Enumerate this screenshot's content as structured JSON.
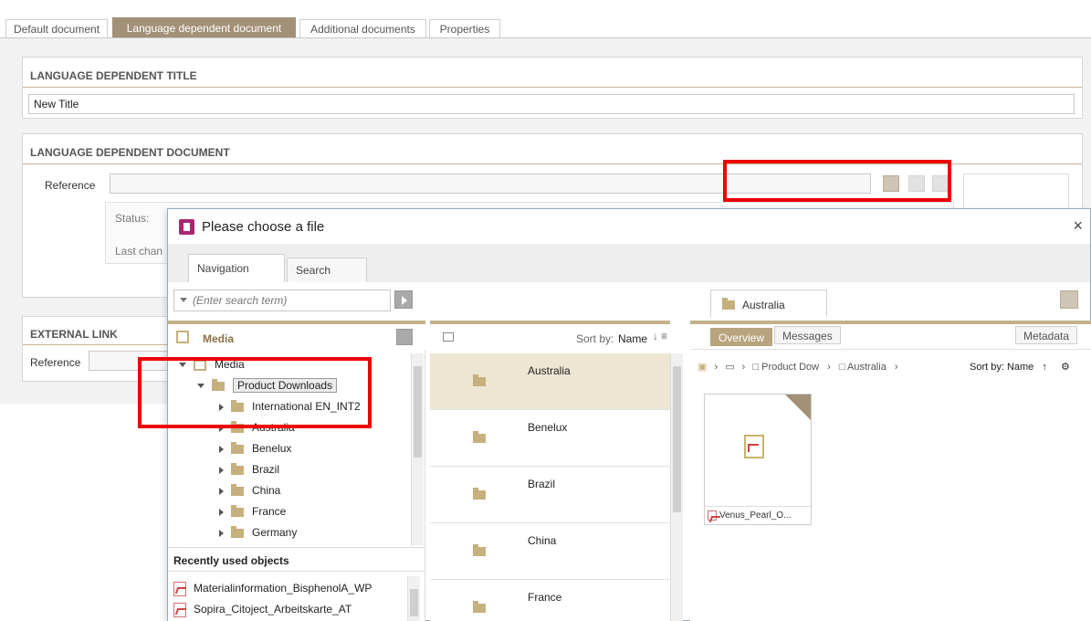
{
  "top_tabs": [
    {
      "label": "Default document"
    },
    {
      "label": "Language dependent document"
    },
    {
      "label": "Additional documents"
    },
    {
      "label": "Properties"
    }
  ],
  "title_panel": {
    "heading": "LANGUAGE DEPENDENT TITLE",
    "value": "New Title"
  },
  "doc_panel": {
    "heading": "LANGUAGE DEPENDENT DOCUMENT",
    "reference_label": "Reference",
    "status_label": "Status:",
    "last_changed_label": "Last chan"
  },
  "link_panel": {
    "heading": "EXTERNAL LINK",
    "reference_label": "Reference"
  },
  "dialog": {
    "title": "Please choose a file",
    "close_label": "×",
    "tabs": [
      {
        "label": "Navigation"
      },
      {
        "label": "Search"
      }
    ],
    "search_placeholder": "(Enter search term)",
    "tree_header": "Media",
    "tree": {
      "root": "Media",
      "selected": "Product Downloads",
      "children": [
        "International EN_INT2",
        "Australia",
        "Benelux",
        "Brazil",
        "China",
        "France",
        "Germany"
      ]
    },
    "recent": {
      "title": "Recently used objects",
      "items": [
        "Materialinformation_BisphenolA_WP",
        "Sopira_Citoject_Arbeitskarte_AT"
      ]
    },
    "list": {
      "sort_label": "Sort by:",
      "sort_value": "Name",
      "items": [
        "Australia",
        "Benelux",
        "Brazil",
        "China",
        "France"
      ]
    },
    "right": {
      "folder_tab": "Australia",
      "tabs": [
        {
          "label": "Overview"
        },
        {
          "label": "Messages"
        }
      ],
      "metadata_label": "Metadata",
      "breadcrumb": [
        "Product Dow",
        "Australia"
      ],
      "sort_label": "Sort by: Name",
      "file_name": "Venus_Pearl_O..."
    }
  },
  "colors": {
    "accent": "#a39077",
    "highlight": "#ee0000",
    "selected_row": "#ede6d3"
  }
}
